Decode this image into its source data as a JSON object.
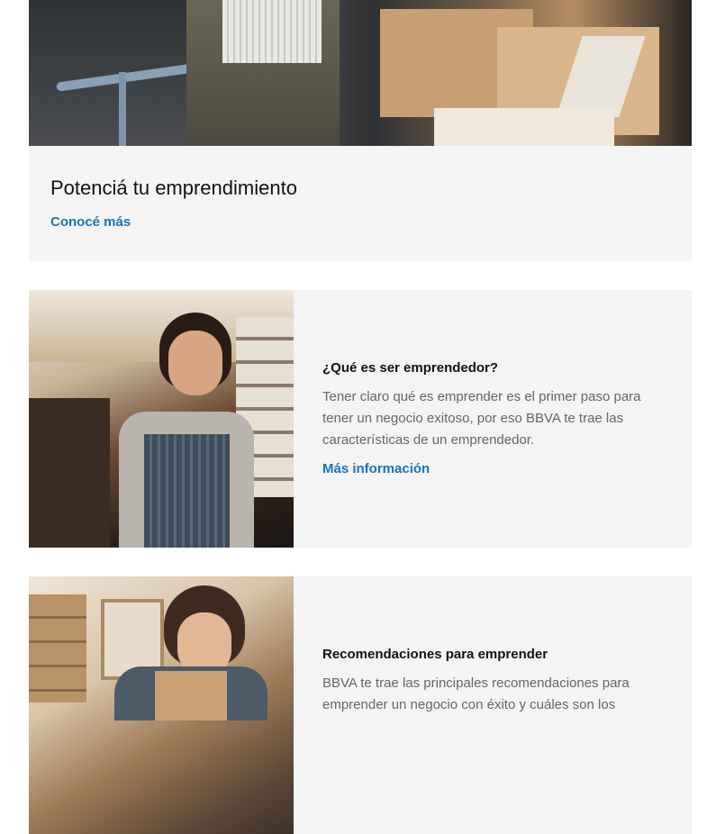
{
  "hero": {
    "image_alt": "Persona preparando cajas de envío junto a una laptop",
    "title": "Potenciá tu emprendimiento",
    "link": "Conocé más"
  },
  "cards": [
    {
      "image_alt": "Hombre sonriente con delantal en una cafetería",
      "title": "¿Qué es ser emprendedor?",
      "description": "Tener claro qué es emprender es el primer paso para tener un negocio exitoso, por eso BBVA te trae las características de un emprendedor.",
      "link": "Más información"
    },
    {
      "image_alt": "Mujer con delantal trabajando en su taller",
      "title": "Recomendaciones para emprender",
      "description": "BBVA te trae las principales recomendaciones para emprender un negocio con éxito y cuáles son los"
    }
  ],
  "colors": {
    "link": "#1973b8",
    "card_background": "#f4f4f4",
    "body_text": "#666666",
    "title_text": "#121212"
  }
}
